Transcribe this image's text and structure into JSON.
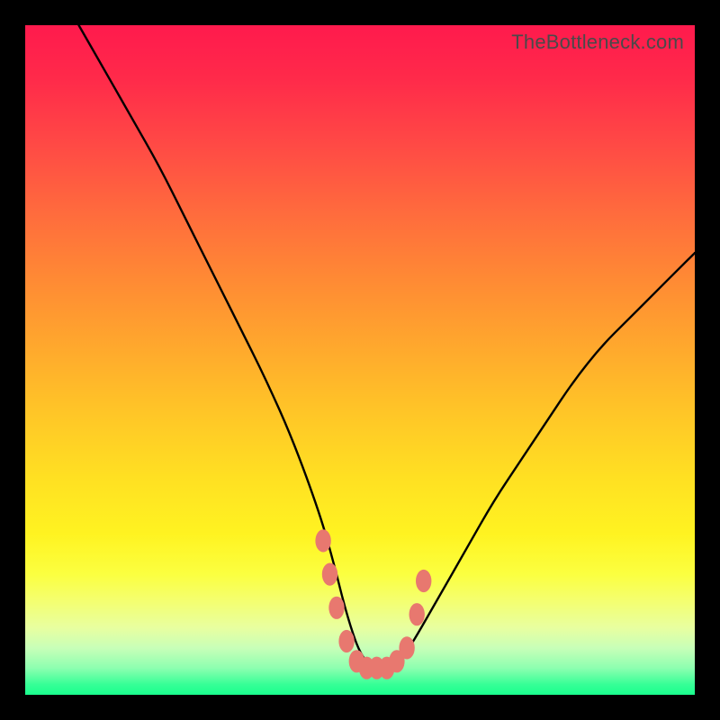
{
  "watermark": "TheBottleneck.com",
  "chart_data": {
    "type": "line",
    "title": "",
    "xlabel": "",
    "ylabel": "",
    "xlim": [
      0,
      100
    ],
    "ylim": [
      0,
      100
    ],
    "grid": false,
    "series": [
      {
        "name": "bottleneck-curve",
        "x": [
          8,
          12,
          16,
          20,
          24,
          28,
          32,
          36,
          40,
          44,
          46,
          48,
          50,
          52,
          54,
          56,
          58,
          62,
          66,
          70,
          74,
          78,
          82,
          86,
          90,
          94,
          98,
          100
        ],
        "values": [
          100,
          93,
          86,
          79,
          71,
          63,
          55,
          47,
          38,
          27,
          20,
          12,
          6,
          4,
          4,
          5,
          8,
          15,
          22,
          29,
          35,
          41,
          47,
          52,
          56,
          60,
          64,
          66
        ]
      }
    ],
    "markers": [
      {
        "x": 44.5,
        "y": 23,
        "r": 1.3
      },
      {
        "x": 45.5,
        "y": 18,
        "r": 1.3
      },
      {
        "x": 46.5,
        "y": 13,
        "r": 1.3
      },
      {
        "x": 48.0,
        "y": 8,
        "r": 1.3
      },
      {
        "x": 49.5,
        "y": 5,
        "r": 1.3
      },
      {
        "x": 51.0,
        "y": 4,
        "r": 1.3
      },
      {
        "x": 52.5,
        "y": 4,
        "r": 1.3
      },
      {
        "x": 54.0,
        "y": 4,
        "r": 1.3
      },
      {
        "x": 55.5,
        "y": 5,
        "r": 1.3
      },
      {
        "x": 57.0,
        "y": 7,
        "r": 1.3
      },
      {
        "x": 58.5,
        "y": 12,
        "r": 1.3
      },
      {
        "x": 59.5,
        "y": 17,
        "r": 1.3
      }
    ],
    "marker_color": "#e8786f",
    "curve_color": "#000000"
  }
}
